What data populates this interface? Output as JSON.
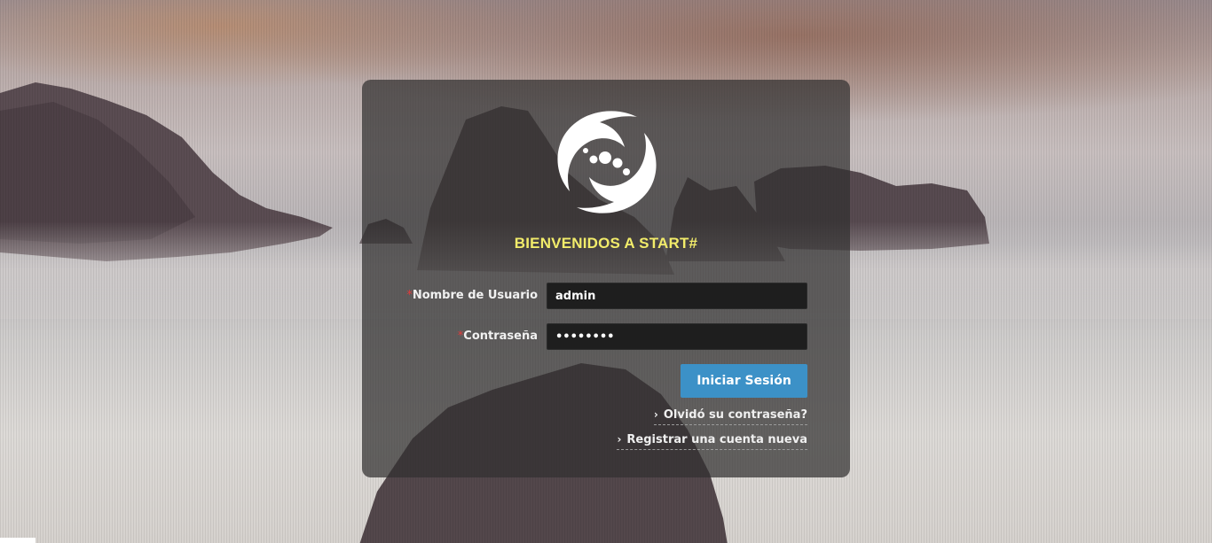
{
  "login": {
    "welcome": "BIENVENIDOS A START#",
    "username_label": "Nombre de Usuario",
    "username_value": "admin",
    "password_label": "Contraseña",
    "password_value": "password",
    "required_mark": "*",
    "submit_label": "Iniciar Sesión",
    "forgot_link": "Olvidó su contraseña?",
    "register_link": "Registrar una cuenta nueva",
    "link_chevron": "›"
  },
  "colors": {
    "welcome": "#f2ec6a",
    "button": "#3c91c7",
    "required": "#e23b3b"
  },
  "icons": [
    "spiral-logo-icon",
    "chevron-right-icon"
  ]
}
